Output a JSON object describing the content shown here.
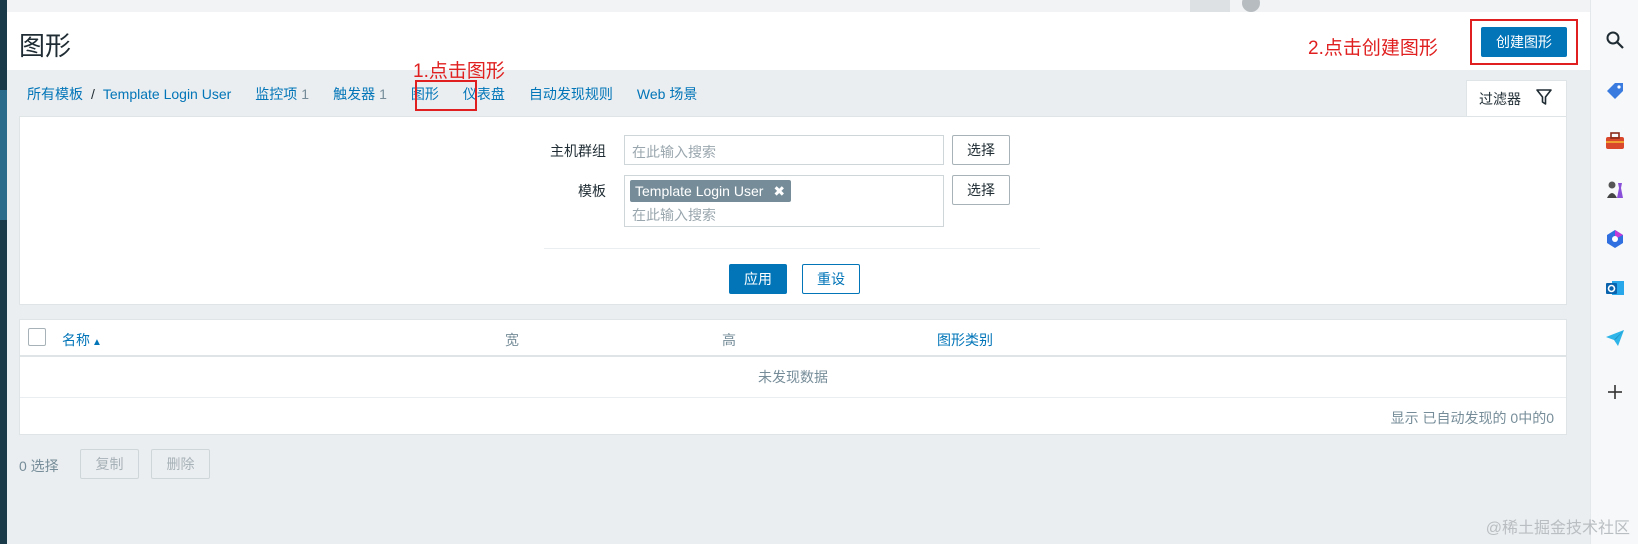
{
  "page": {
    "title": "图形",
    "create_button": "创建图形"
  },
  "annotations": {
    "step1": "1.点击图形",
    "step2": "2.点击创建图形"
  },
  "breadcrumb": {
    "all_templates": "所有模板",
    "separator": "/",
    "template_name": "Template Login User"
  },
  "tabs": [
    {
      "label": "监控项",
      "count": "1"
    },
    {
      "label": "触发器",
      "count": "1"
    },
    {
      "label": "图形",
      "count": ""
    },
    {
      "label": "仪表盘",
      "count": ""
    },
    {
      "label": "自动发现规则",
      "count": ""
    },
    {
      "label": "Web 场景",
      "count": ""
    }
  ],
  "filter": {
    "tab_label": "过滤器",
    "host_group_label": "主机群组",
    "host_group_placeholder": "在此输入搜索",
    "template_label": "模板",
    "template_tag": "Template Login User",
    "template_placeholder": "在此输入搜索",
    "select_label": "选择",
    "apply_label": "应用",
    "reset_label": "重设"
  },
  "table": {
    "columns": [
      "名称",
      "宽",
      "高",
      "图形类别"
    ],
    "sort_indicator": "▲",
    "empty_text": "未发现数据",
    "footer_text": "显示 已自动发现的 0中的0"
  },
  "actions": {
    "selected_count": "0 选择",
    "copy_label": "复制",
    "delete_label": "删除"
  },
  "sidebar_icons": [
    "search-icon",
    "tag-icon",
    "toolbox-icon",
    "chess-icon",
    "copilot-icon",
    "outlook-icon",
    "send-icon",
    "plus-icon"
  ],
  "watermark": "@稀土掘金技术社区",
  "colors": {
    "accent": "#0275b8",
    "annotation": "#e02020",
    "background": "#ebeef0"
  }
}
